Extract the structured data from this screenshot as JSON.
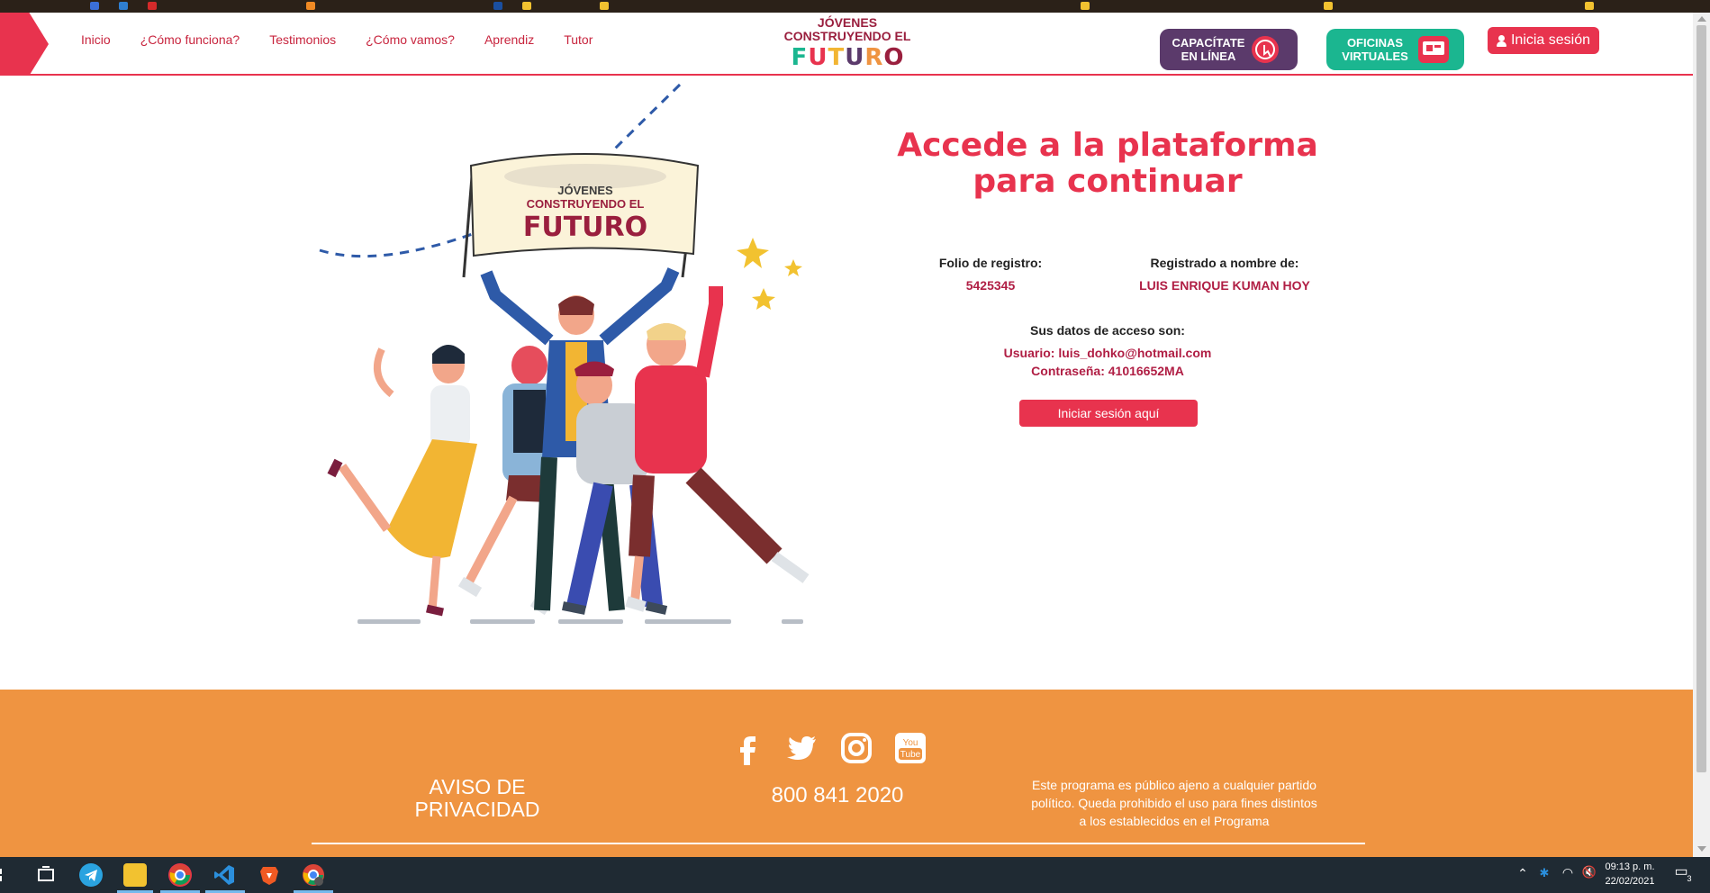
{
  "header": {
    "nav": [
      "Inicio",
      "¿Cómo funciona?",
      "Testimonios",
      "¿Cómo vamos?",
      "Aprendiz",
      "Tutor"
    ],
    "logo": {
      "line1": "JÓVENES",
      "line2": "CONSTRUYENDO EL",
      "line3": "FUTURO"
    },
    "capacitate": "CAPACÍTATE EN LÍNEA",
    "oficinas": "OFICINAS VIRTUALES",
    "login": "Inicia sesión"
  },
  "illustration": {
    "banner_line1": "JÓVENES",
    "banner_line2": "CONSTRUYENDO EL",
    "banner_line3": "FUTURO"
  },
  "main": {
    "title_line1": "Accede a la plataforma",
    "title_line2": "para continuar",
    "folio_label": "Folio de registro:",
    "folio_value": "5425345",
    "name_label": "Registrado a nombre de:",
    "name_value": "LUIS ENRIQUE KUMAN HOY",
    "access_label": "Sus datos de acceso son:",
    "user_line": "Usuario: luis_dohko@hotmail.com",
    "password_line": "Contraseña: 41016652MA",
    "cta": "Iniciar sesión aquí"
  },
  "footer": {
    "aviso": "AVISO DE PRIVACIDAD",
    "phone": "800 841 2020",
    "disclaimer": "Este programa es público ajeno a cualquier partido político. Queda prohibido el uso para fines distintos a los establecidos en el Programa",
    "social": [
      "facebook-icon",
      "twitter-icon",
      "instagram-icon",
      "youtube-icon"
    ]
  },
  "taskbar": {
    "time": "09:13 p. m.",
    "date": "22/02/2021",
    "notifications": "3"
  },
  "colors": {
    "brand_red": "#e8334e",
    "brand_wine": "#9a1f3e",
    "footer_orange": "#ef9441",
    "capacitate_purple": "#5b3a6b",
    "oficinas_green": "#1bb690"
  }
}
